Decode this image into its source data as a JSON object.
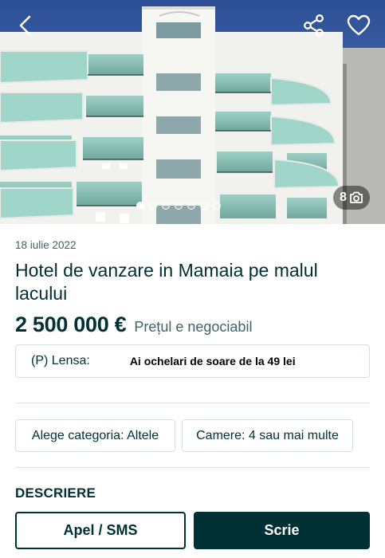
{
  "gallery": {
    "photo_count": "8",
    "total_dots": 7,
    "active_index": 0,
    "camera_icon": "camera-icon",
    "back_icon": "back-arrow-icon",
    "share_icon": "share-icon",
    "favorite_icon": "heart-icon"
  },
  "listing": {
    "date": "18 iulie 2022",
    "title": "Hotel de vanzare in Mamaia pe malul lacului",
    "price": "2 500 000 €",
    "negotiable": "Prețul e negociabil"
  },
  "ad": {
    "source": "(P) Lensa:",
    "text": "Ai ochelari de soare de la 49 lei"
  },
  "attributes": [
    {
      "label": "Alege categoria: Altele"
    },
    {
      "label": "Camere: 4 sau mai multe"
    }
  ],
  "description": {
    "heading": "DESCRIERE"
  },
  "actions": {
    "call_label": "Apel / SMS",
    "write_label": "Scrie"
  },
  "colors": {
    "primary": "#002f34",
    "secondary_text": "#406367",
    "border": "#d8dfe0"
  }
}
